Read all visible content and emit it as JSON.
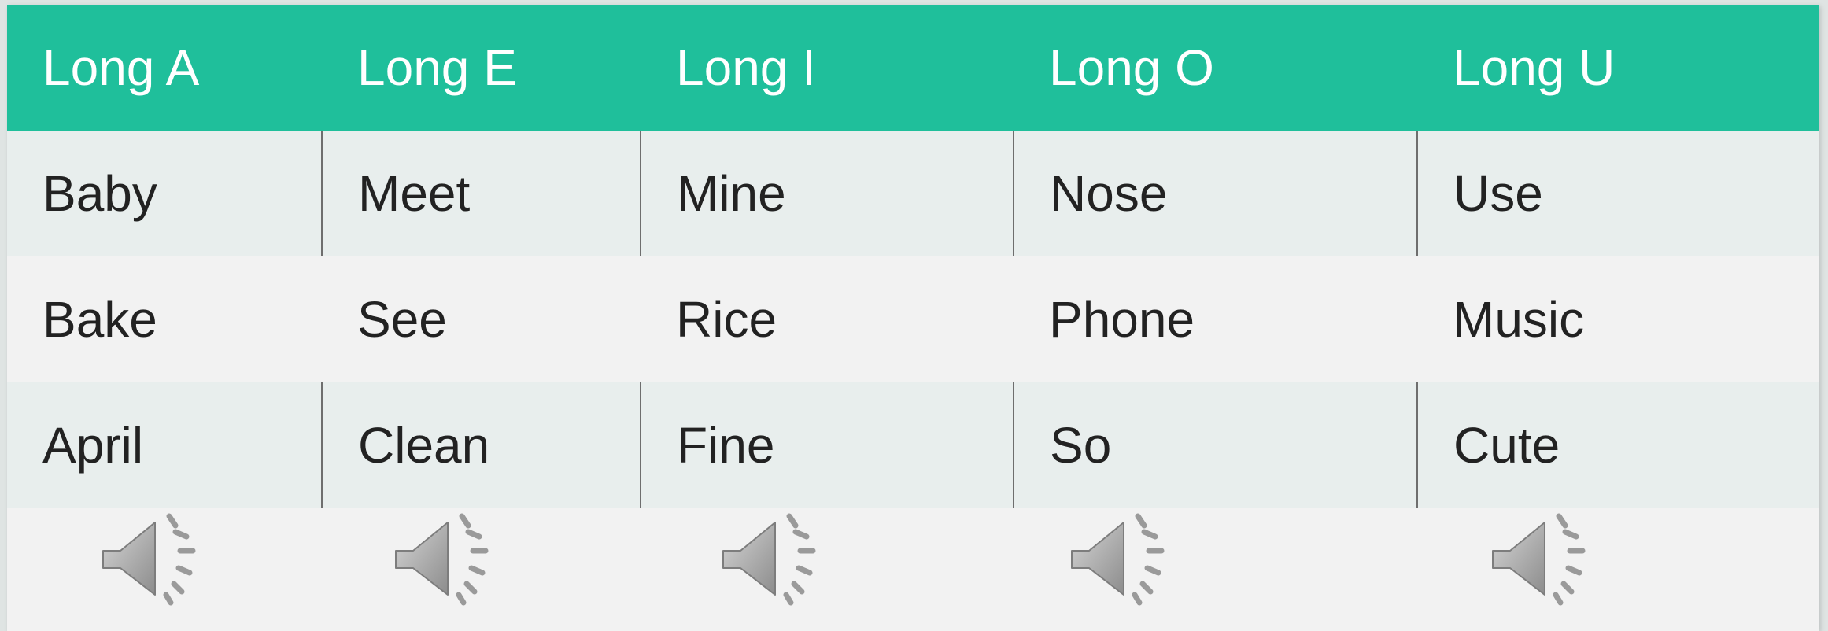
{
  "table": {
    "headers": [
      "Long A",
      "Long E",
      "Long I",
      "Long O",
      "Long U"
    ],
    "rows": [
      [
        "Baby",
        "Meet",
        "Mine",
        "Nose",
        "Use"
      ],
      [
        "Bake",
        "See",
        "Rice",
        "Phone",
        "Music"
      ],
      [
        "April",
        "Clean",
        "Fine",
        "So",
        "Cute"
      ]
    ]
  },
  "audio_icons": [
    "speaker-icon",
    "speaker-icon",
    "speaker-icon",
    "speaker-icon",
    "speaker-icon"
  ],
  "colors": {
    "header_bg": "#1fbf9b",
    "header_text": "#ffffff",
    "row_band": "#e8eeed",
    "row_plain": "#f2f2f2",
    "text": "#222222"
  }
}
